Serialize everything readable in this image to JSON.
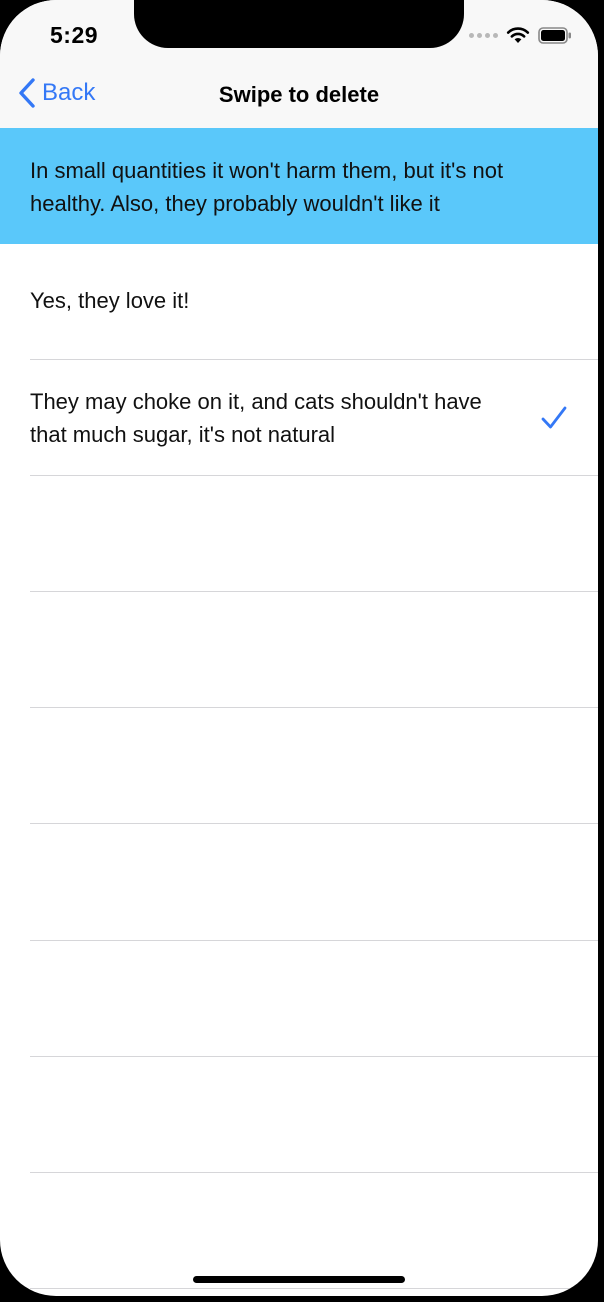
{
  "status_bar": {
    "time": "5:29",
    "icons": [
      "signal-dots-icon",
      "wifi-icon",
      "battery-icon"
    ]
  },
  "nav": {
    "back_label": "Back",
    "title": "Swipe to delete"
  },
  "colors": {
    "accent": "#3478f6",
    "highlight_row": "#5ac8fa",
    "separator": "#d6d6d9"
  },
  "rows": [
    {
      "text": "In small quantities it won't harm them, but it's not healthy. Also, they probably wouldn't like it",
      "highlighted": true,
      "checked": false
    },
    {
      "text": "Yes, they love it!",
      "highlighted": false,
      "checked": false
    },
    {
      "text": "They may choke on it, and cats shouldn't have that much sugar, it's not natural",
      "highlighted": false,
      "checked": true
    }
  ],
  "empty_row_count": 7
}
